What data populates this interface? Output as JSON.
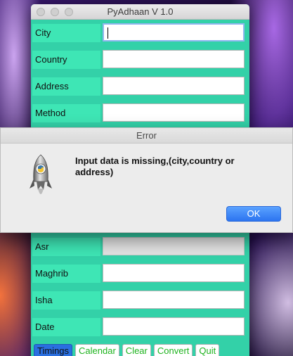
{
  "window": {
    "title": "PyAdhaan V 1.0",
    "fields": {
      "city": {
        "label": "City",
        "value": ""
      },
      "country": {
        "label": "Country",
        "value": ""
      },
      "address": {
        "label": "Address",
        "value": ""
      },
      "method": {
        "label": "Method",
        "value": ""
      },
      "asr": {
        "label": "Asr",
        "value": ""
      },
      "maghrib": {
        "label": "Maghrib",
        "value": ""
      },
      "isha": {
        "label": "Isha",
        "value": ""
      },
      "date": {
        "label": "Date",
        "value": ""
      }
    },
    "buttons": {
      "timings": "Timings",
      "calendar": "Calendar",
      "clear": "Clear",
      "convert": "Convert",
      "quit": "Quit"
    }
  },
  "dialog": {
    "title": "Error",
    "message": "Input data is missing,(city,country or address)",
    "ok_label": "OK",
    "icon": "python-rocket-icon"
  },
  "colors": {
    "window_bg": "#33d1a8",
    "label_bg": "#3ee6b5",
    "button_text": "#1db31d",
    "primary_button": "#2a6fe0"
  }
}
